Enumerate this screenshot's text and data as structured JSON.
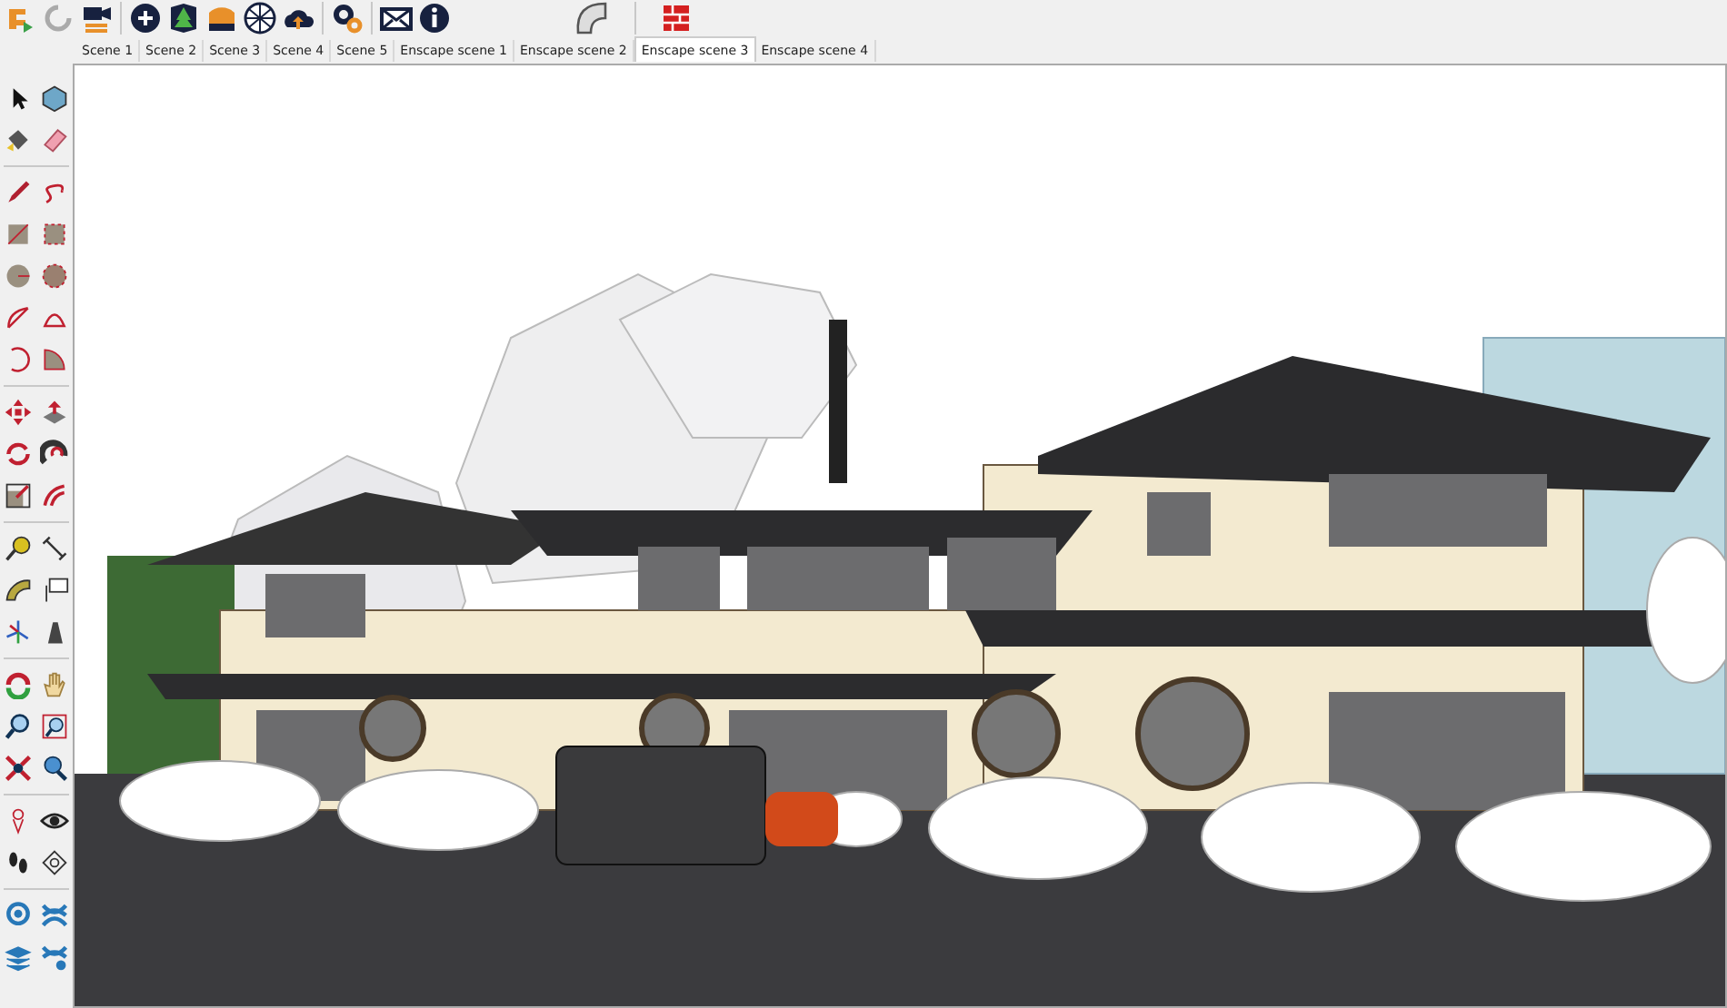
{
  "scene_tabs": [
    {
      "label": "Scene 1",
      "selected": false
    },
    {
      "label": "Scene 2",
      "selected": false
    },
    {
      "label": "Scene 3",
      "selected": false
    },
    {
      "label": "Scene 4",
      "selected": false
    },
    {
      "label": "Scene 5",
      "selected": false
    },
    {
      "label": "Enscape scene 1",
      "selected": false
    },
    {
      "label": "Enscape scene 2",
      "selected": false
    },
    {
      "label": "Enscape scene 3",
      "selected": true
    },
    {
      "label": "Enscape scene 4",
      "selected": false
    }
  ]
}
